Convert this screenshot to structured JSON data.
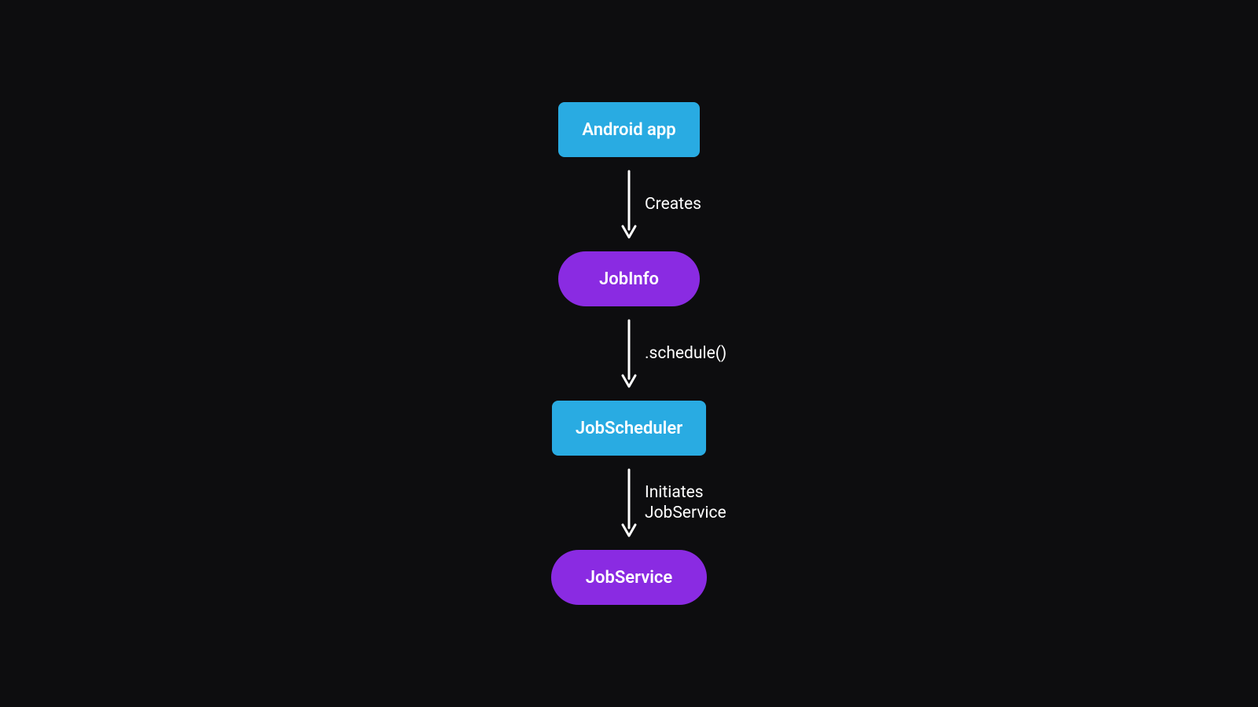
{
  "nodes": {
    "android_app": "Android app",
    "job_info": "JobInfo",
    "job_scheduler": "JobScheduler",
    "job_service": "JobService"
  },
  "arrows": {
    "creates": "Creates",
    "schedule": ".schedule()",
    "initiates_line1": "Initiates",
    "initiates_line2": "JobService"
  },
  "colors": {
    "background": "#0d0d0f",
    "rect_node": "#29abe2",
    "pill_node": "#8a2be2",
    "text": "#ffffff",
    "arrow": "#ffffff"
  }
}
